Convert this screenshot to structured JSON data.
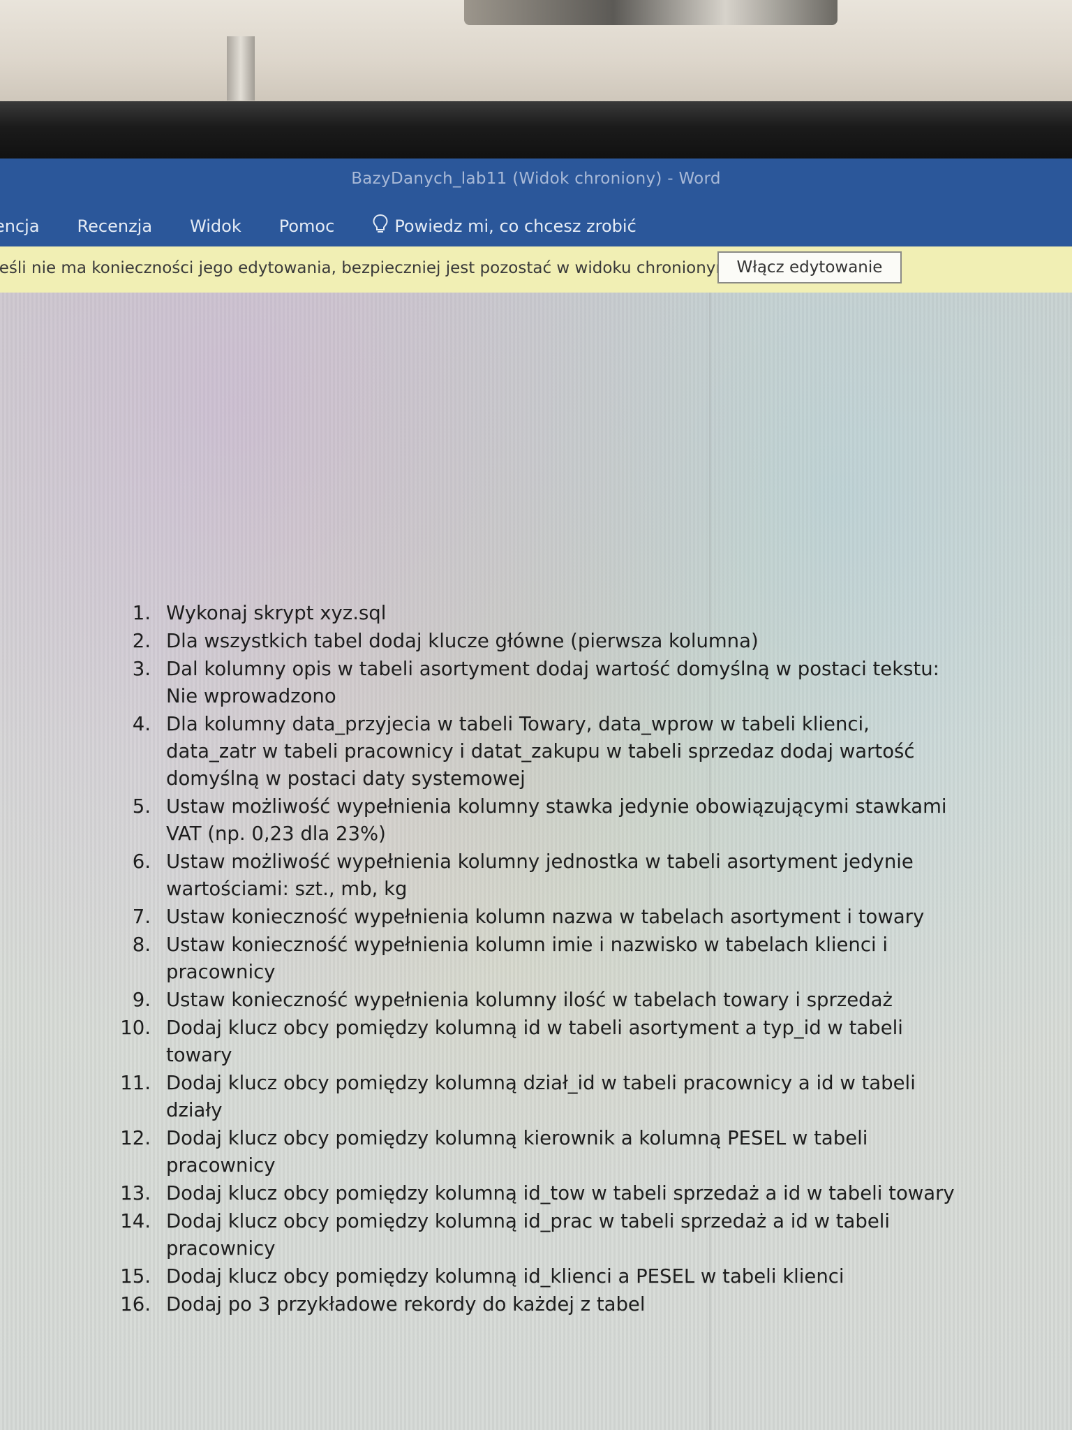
{
  "window": {
    "title": "BazyDanych_lab11 (Widok chroniony)  -  Word"
  },
  "ribbon": {
    "tabs": [
      "encja",
      "Recenzja",
      "Widok",
      "Pomoc"
    ],
    "tell_me": "Powiedz mi, co chcesz zrobić"
  },
  "protected_view": {
    "message": "Jeśli nie ma konieczności jego edytowania, bezpieczniej jest pozostać w widoku chronionym.",
    "button_label": "Włącz edytowanie"
  },
  "document": {
    "tasks": [
      {
        "num": "1.",
        "text": "Wykonaj skrypt xyz.sql"
      },
      {
        "num": "2.",
        "text": "Dla wszystkich tabel dodaj klucze główne (pierwsza kolumna)"
      },
      {
        "num": "3.",
        "text": "Dal kolumny opis w tabeli asortyment dodaj wartość domyślną w postaci tekstu: Nie wprowadzono"
      },
      {
        "num": "4.",
        "text": "Dla kolumny data_przyjecia w tabeli Towary, data_wprow w tabeli klienci, data_zatr w tabeli pracownicy i datat_zakupu w tabeli sprzedaz dodaj wartość domyślną w postaci daty systemowej"
      },
      {
        "num": "5.",
        "text": "Ustaw możliwość wypełnienia kolumny stawka jedynie obowiązującymi stawkami VAT (np. 0,23 dla 23%)"
      },
      {
        "num": "6.",
        "text": "Ustaw możliwość wypełnienia kolumny jednostka w tabeli asortyment jedynie wartościami: szt., mb, kg"
      },
      {
        "num": "7.",
        "text": "Ustaw konieczność wypełnienia kolumn nazwa w tabelach asortyment i towary"
      },
      {
        "num": "8.",
        "text": "Ustaw konieczność wypełnienia kolumn imie i nazwisko w tabelach klienci i pracownicy"
      },
      {
        "num": "9.",
        "text": "Ustaw konieczność wypełnienia kolumny ilość w tabelach towary i sprzedaż"
      },
      {
        "num": "10.",
        "text": "Dodaj klucz obcy pomiędzy kolumną id w tabeli asortyment a typ_id w tabeli towary"
      },
      {
        "num": "11.",
        "text": "Dodaj klucz obcy pomiędzy kolumną dział_id w tabeli pracownicy a id w tabeli działy"
      },
      {
        "num": "12.",
        "text": "Dodaj klucz obcy pomiędzy kolumną kierownik a kolumną PESEL w tabeli pracownicy"
      },
      {
        "num": "13.",
        "text": "Dodaj klucz obcy pomiędzy kolumną id_tow w tabeli sprzedaż a id w tabeli towary"
      },
      {
        "num": "14.",
        "text": "Dodaj klucz obcy pomiędzy kolumną id_prac w tabeli sprzedaż a id w tabeli pracownicy"
      },
      {
        "num": "15.",
        "text": "Dodaj klucz obcy pomiędzy kolumną id_klienci a PESEL w tabeli klienci"
      },
      {
        "num": "16.",
        "text": "Dodaj po 3 przykładowe rekordy do każdej z tabel"
      }
    ]
  },
  "colors": {
    "title_bar": "#2b579a",
    "message_bar": "#f1efb4"
  }
}
